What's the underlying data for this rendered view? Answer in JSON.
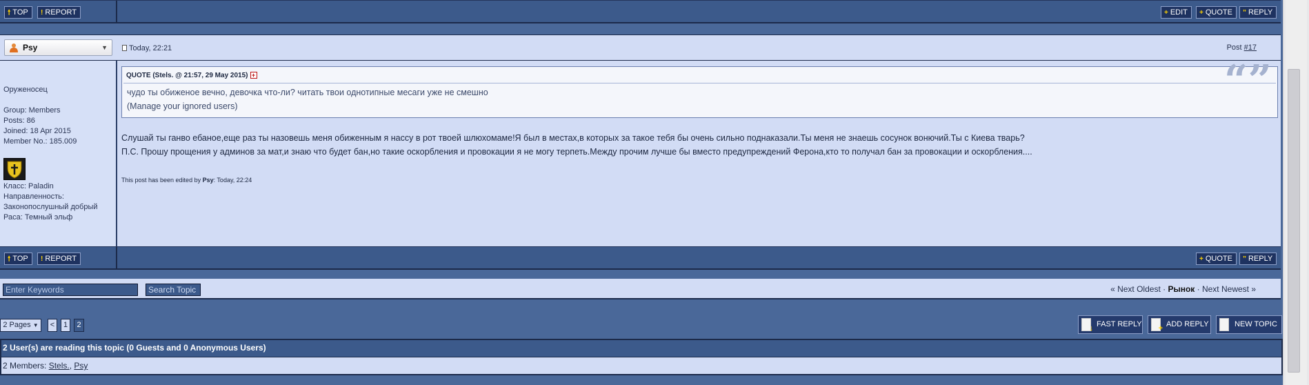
{
  "top_bar": {
    "top_label": "TOP",
    "report_label": "REPORT",
    "edit_label": "EDIT",
    "quote_label": "QUOTE",
    "reply_label": "REPLY"
  },
  "post": {
    "author": "Psy",
    "date": "Today, 22:21",
    "post_label": "Post ",
    "post_number": "#17",
    "author_info": {
      "title": "Оруженосец",
      "group": "Group: Members",
      "posts": "Posts: 86",
      "joined": "Joined: 18 Apr 2015",
      "member_no": "Member No.: 185.009",
      "class": "Класс: Paladin",
      "direction": "Направленность:",
      "alignment": "Законопослушный добрый",
      "race": "Раса: Темный эльф"
    },
    "quote": {
      "header": "QUOTE (Stels. @ 21:57, 29 May 2015)",
      "text": "чудо ты обиженое вечно, девочка что-ли? читать твои однотипные месаги уже не смешно",
      "ignored": "(Manage your ignored users)"
    },
    "text_line1": "Слушай ты ганво ебаное,еще раз ты назовешь меня обиженным я нассу в рот твоей шлюхомаме!Я был в местах,в которых за такое тебя бы очень сильно поднаказали.Ты меня не знаешь сосунок вонючий.Ты с Киева тварь?",
    "text_line2": "П.С. Прошу прощения у админов за мат,и знаю что будет бан,но такие оскорбления и провокации я не могу терпеть.Между прочим лучше бы вместо предупреждений Ферона,кто то получал бан за провокации и оскорбления....",
    "edit_note_prefix": "This post has been edited by ",
    "edit_note_user": "Psy",
    "edit_note_suffix": ": Today, 22:24"
  },
  "bottom_bar": {
    "top_label": "TOP",
    "report_label": "REPORT",
    "quote_label": "QUOTE",
    "reply_label": "REPLY"
  },
  "search": {
    "placeholder": "Enter Keywords",
    "button_label": "Search Topic"
  },
  "topic_nav": {
    "prev": "« Next Oldest",
    "sep1": " · ",
    "current": "Рынок",
    "sep2": " · ",
    "next": "Next Newest »"
  },
  "pagination": {
    "pages_label": "2 Pages",
    "prev": "<",
    "page1": "1",
    "page2": "2"
  },
  "actions": {
    "fast_reply": "FAST REPLY",
    "add_reply": "ADD REPLY",
    "new_topic": "NEW TOPIC"
  },
  "reading": {
    "header": "2 User(s) are reading this topic (0 Guests and 0 Anonymous Users)",
    "members_label": "2 Members: ",
    "member1": "Stels.",
    "separator": ", ",
    "member2": "Psy"
  },
  "colors": {
    "page_bg": "#4a6899",
    "bar_bg": "#3c5a8b",
    "panel_bg": "#d2dcf5",
    "button_bg": "#1e3260",
    "icon_accent": "#ffd200"
  }
}
